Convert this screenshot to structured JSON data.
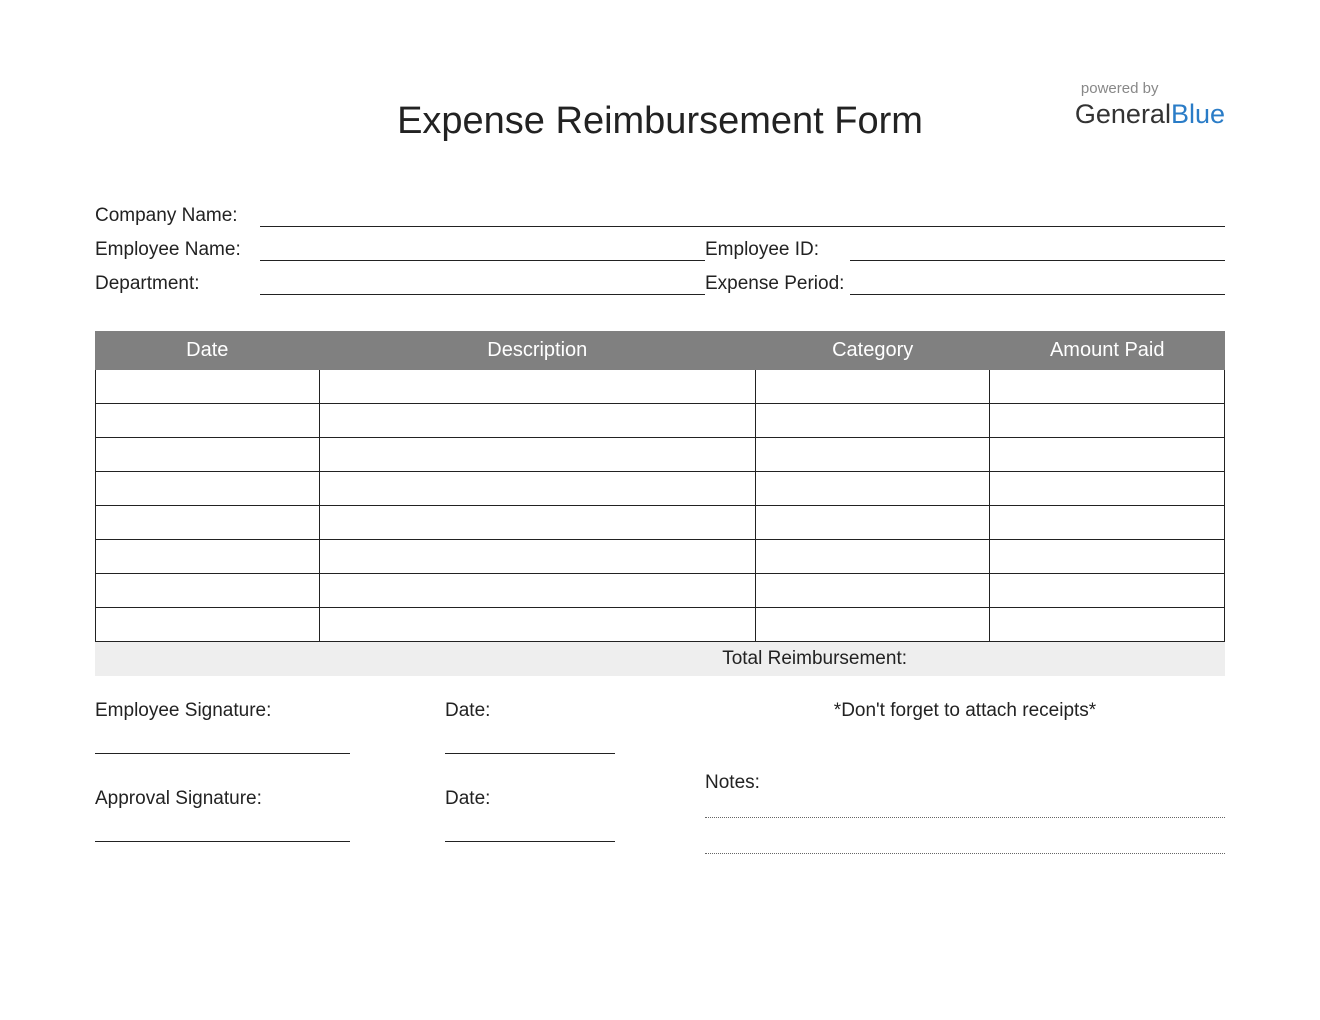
{
  "title": "Expense Reimbursement Form",
  "logo": {
    "powered": "powered by",
    "brand_part1": "General",
    "brand_part2": "Blue"
  },
  "info": {
    "company_label": "Company Name:",
    "employee_name_label": "Employee Name:",
    "employee_id_label": "Employee ID:",
    "department_label": "Department:",
    "expense_period_label": "Expense Period:"
  },
  "table": {
    "headers": {
      "date": "Date",
      "description": "Description",
      "category": "Category",
      "amount": "Amount Paid"
    },
    "row_count": 8,
    "total_label": "Total Reimbursement:"
  },
  "footer": {
    "employee_sig_label": "Employee Signature:",
    "approval_sig_label": "Approval Signature:",
    "date_label": "Date:",
    "reminder": "*Don't forget to attach receipts*",
    "notes_label": "Notes:"
  }
}
